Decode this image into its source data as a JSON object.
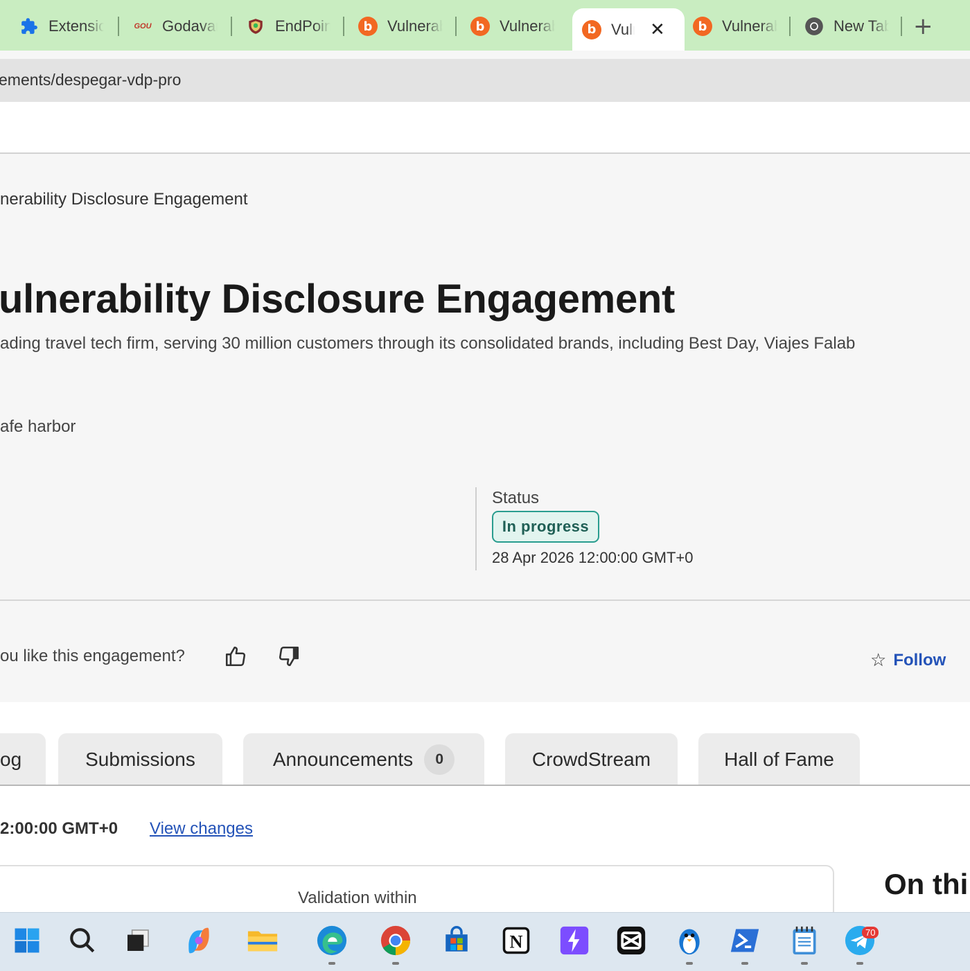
{
  "browser": {
    "tabs": [
      {
        "title": "Extensions",
        "icon": "puzzle-icon"
      },
      {
        "title": "Godavari",
        "icon": "godavari-logo-icon",
        "icon_text": "GOU"
      },
      {
        "title": "EndPoint",
        "icon": "shield-logo-icon"
      },
      {
        "title": "Vulnerability",
        "icon": "bugcrowd-icon"
      },
      {
        "title": "Vulnerability",
        "icon": "bugcrowd-icon"
      },
      {
        "title": "Vulnerability",
        "icon": "bugcrowd-icon",
        "active": true
      },
      {
        "title": "Vulnerability",
        "icon": "bugcrowd-icon"
      },
      {
        "title": "New Tab",
        "icon": "chrome-icon"
      }
    ],
    "address": "ements/despegar-vdp-pro"
  },
  "page": {
    "breadcrumb": "nerability Disclosure Engagement",
    "title": "ulnerability Disclosure Engagement",
    "description": "ading travel tech firm, serving 30 million customers through its consolidated brands, including Best Day, Viajes Falab",
    "safe_harbor": "afe harbor",
    "status_label": "Status",
    "status_value": "In progress",
    "status_date": "28 Apr 2026 12:00:00 GMT+0",
    "like_question": "ou like this engagement?",
    "follow_label": "Follow"
  },
  "tabs": [
    {
      "label": "og"
    },
    {
      "label": "Submissions"
    },
    {
      "label": "Announcements",
      "count": "0"
    },
    {
      "label": "CrowdStream"
    },
    {
      "label": "Hall of Fame"
    }
  ],
  "content": {
    "updated_time": "2:00:00 GMT+0",
    "view_changes": "View changes",
    "validation_label": "Validation within",
    "on_this_page": "On thi"
  },
  "taskbar": {
    "icons": [
      "windows-start-icon",
      "search-icon",
      "task-view-icon",
      "copilot-icon",
      "file-explorer-icon",
      "edge-icon",
      "chrome-icon",
      "store-icon",
      "notion-icon",
      "bolt-app-icon",
      "capcut-icon",
      "penguin-app-icon",
      "powershell-icon",
      "notepad-icon",
      "telegram-icon"
    ],
    "telegram_badge": "70"
  },
  "colors": {
    "tabstrip": "#c9edc1",
    "accent_link": "#2453b8",
    "status_border": "#2a9d8f",
    "bugcrowd_orange": "#f26822"
  }
}
